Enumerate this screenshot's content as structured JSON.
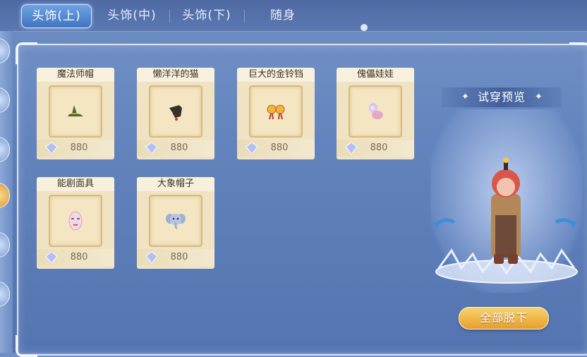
{
  "tabs": [
    {
      "label": "头饰(上)",
      "active": true
    },
    {
      "label": "头饰(中)",
      "active": false
    },
    {
      "label": "头饰(下)",
      "active": false
    },
    {
      "label": "随身",
      "active": false
    }
  ],
  "items": [
    {
      "name": "魔法师帽",
      "price": "880",
      "icon": "witch-hat-icon"
    },
    {
      "name": "懒洋洋的猫",
      "price": "880",
      "icon": "lazy-cat-icon"
    },
    {
      "name": "巨大的金铃铛",
      "price": "880",
      "icon": "golden-bell-icon"
    },
    {
      "name": "傀儡娃娃",
      "price": "880",
      "icon": "puppet-doll-icon"
    },
    {
      "name": "能剧面具",
      "price": "880",
      "icon": "noh-mask-icon"
    },
    {
      "name": "大象帽子",
      "price": "880",
      "icon": "elephant-hat-icon"
    }
  ],
  "preview": {
    "title": "试穿预览",
    "undress_all_label": "全部脱下"
  },
  "currency_icon": "diamond-gem-icon",
  "colors": {
    "accent_gold": "#e9a233",
    "tab_active": "#4a80c8"
  }
}
